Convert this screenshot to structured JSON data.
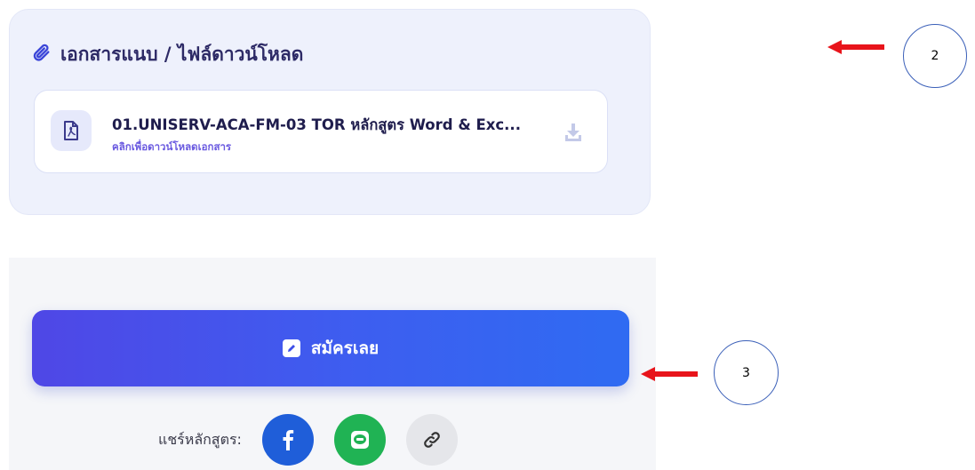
{
  "attachments": {
    "title": "เอกสารแนบ / ไฟล์ดาวน์โหลด",
    "file": {
      "name": "01.UNISERV-ACA-FM-03 TOR หลักสูตร Word & Exc...",
      "subtitle": "คลิกเพื่อดาวน์โหลดเอกสาร"
    }
  },
  "apply": {
    "label": "สมัครเลย"
  },
  "share": {
    "label": "แชร์หลักสูตร:",
    "buttons": [
      "facebook-icon",
      "line-icon",
      "link-icon"
    ]
  },
  "annotations": [
    {
      "label": "2"
    },
    {
      "label": "3"
    }
  ],
  "colors": {
    "accent": "#4f47e6",
    "facebook": "#1f5ed9",
    "line": "#20b354",
    "annotation_arrow": "#e8141b"
  }
}
